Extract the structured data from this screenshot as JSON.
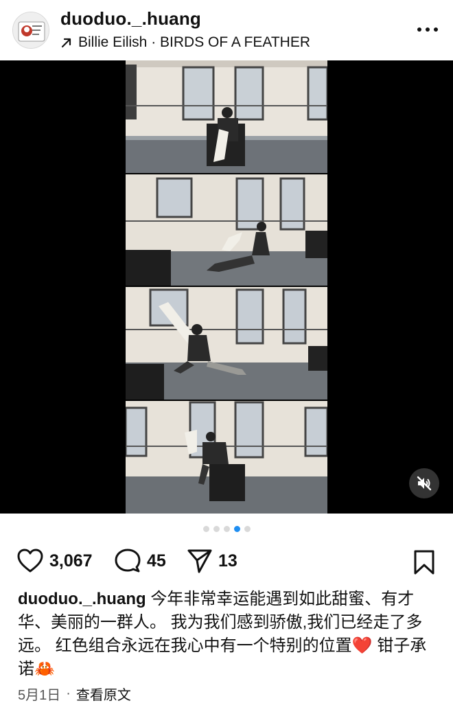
{
  "post": {
    "username": "duoduo._.huang",
    "music": {
      "arrow_icon": "arrow-up-right-icon",
      "text": "Billie Eilish · BIRDS OF A FEATHER"
    }
  },
  "carousel": {
    "total": 5,
    "active_index": 3
  },
  "actions": {
    "likes": "3,067",
    "comments": "45",
    "shares": "13"
  },
  "caption": {
    "username": "duoduo._.huang",
    "text": "今年非常幸运能遇到如此甜蜜、有才华、美丽的一群人。 我为我们感到骄傲,我们已经走了多远。 红色组合永远在我心中有一个特别的位置",
    "emoji_1": "❤️",
    "text_2": "钳子承诺",
    "emoji_2": "🦀"
  },
  "meta": {
    "date": "5月1日",
    "separator": "·",
    "translate_link": "查看原文"
  },
  "colors": {
    "accent": "#1f8ef1",
    "media_bg": "#000000"
  }
}
